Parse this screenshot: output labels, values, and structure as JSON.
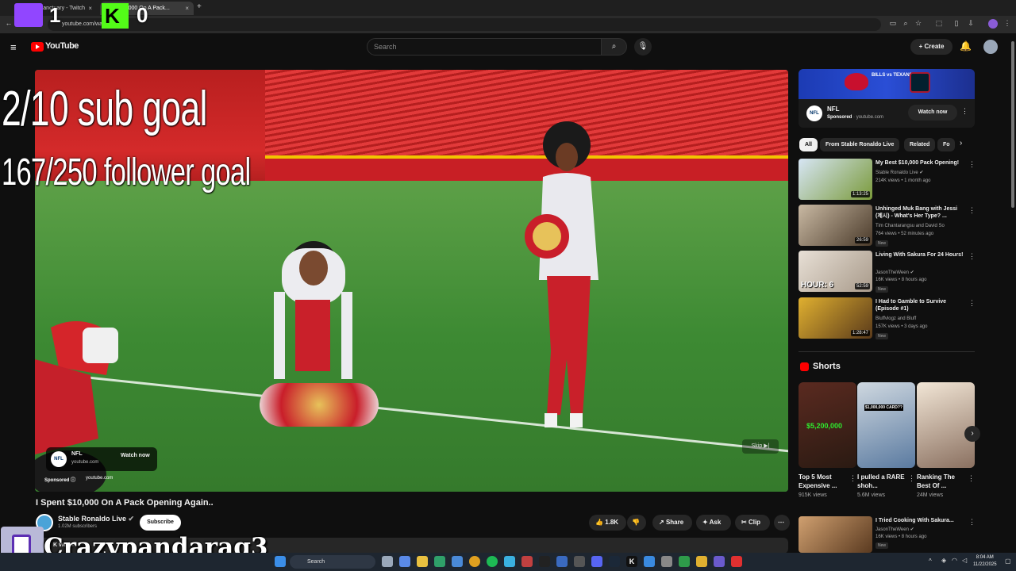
{
  "browser": {
    "tabs": [
      {
        "label": "yourSanctuary - Twitch",
        "close": "×"
      },
      {
        "label": "$10,000 On A Pack...",
        "close": "×"
      }
    ],
    "new_tab": "+",
    "url": "youtube.com/wa...7Vn9o2I"
  },
  "overlay": {
    "counter_left": "1",
    "counter_right": "0",
    "sub_goal": "2/10 sub goal",
    "follower_goal": "167/250 follower goal",
    "streamer_name": "Crazypandarag3"
  },
  "youtube": {
    "logo": "YouTube",
    "search_placeholder": "Search",
    "create_label": "Create"
  },
  "player": {
    "ad_channel": "NFL",
    "ad_url": "youtube.com",
    "ad_cta": "Watch now",
    "sponsored": "Sponsored",
    "sponsored_url": "youtube.com",
    "skip": "Skip"
  },
  "video": {
    "title": "I Spent $10,000 On A Pack Opening Again..",
    "channel": "Stable Ronaldo Live",
    "subscribers": "1.02M subscribers",
    "subscribe_label": "Subscribe",
    "likes": "1.8K",
    "share": "Share",
    "ask": "Ask",
    "clip": "Clip",
    "views_partial": "K views"
  },
  "sidebar_ad": {
    "banner_text": "BILLS vs TEXANS",
    "channel": "NFL",
    "sponsored": "Sponsored",
    "url": "youtube.com",
    "cta": "Watch now"
  },
  "chips": [
    "All",
    "From Stable Ronaldo Live",
    "Related",
    "Fo"
  ],
  "recommendations": [
    {
      "title": "My Best $10,000 Pack Opening!",
      "channel": "Stable Ronaldo Live",
      "meta": "214K views • 1 month ago",
      "duration": "1:13:25",
      "badge": ""
    },
    {
      "title": "Unhinged Muk Bang with Jessi (제시) - What's Her Type? ...",
      "channel": "Tim Chantarangsu and David So",
      "meta": "764 views • 52 minutes ago",
      "duration": "26:59",
      "badge": "New"
    },
    {
      "title": "Living With Sakura For 24 Hours!",
      "channel": "JasonTheWeen",
      "meta": "16K views • 8 hours ago",
      "duration": "52:59",
      "badge": "New",
      "thumb_text": "HOUR: 6"
    },
    {
      "title": "I Had to Gamble to Survive (Episode #1)",
      "channel": "Bluffvlogz and Bluff",
      "meta": "157K views • 3 days ago",
      "duration": "1:28:47",
      "badge": "New"
    }
  ],
  "shorts": {
    "heading": "Shorts",
    "items": [
      {
        "title": "Top 5 Most Expensive ...",
        "views": "915K views",
        "thumb_text": "$5,200,000"
      },
      {
        "title": "I pulled a RARE shoh...",
        "views": "5.6M views",
        "thumb_text": "$1,000,000 CARD??"
      },
      {
        "title": "Ranking The Best Of ...",
        "views": "24M views",
        "thumb_text": ""
      }
    ]
  },
  "rec_bottom": {
    "title": "I Tried Cooking With Sakura...",
    "channel": "JasonTheWeen",
    "meta": "16K views • 8 hours ago",
    "badge": "New"
  },
  "taskbar": {
    "search": "Search",
    "time": "8:04 AM",
    "date": "11/22/2025"
  }
}
